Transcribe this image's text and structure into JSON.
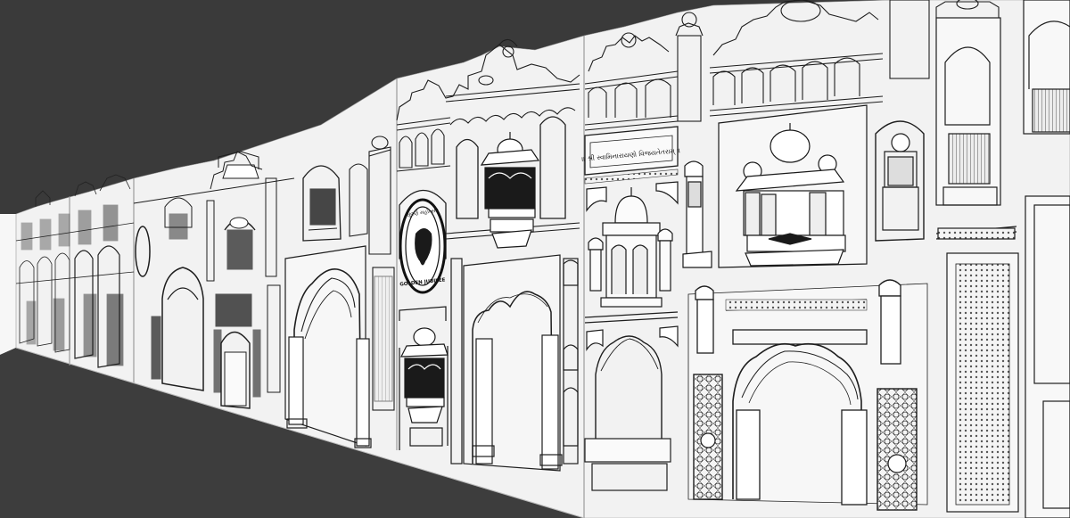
{
  "scene": {
    "background_color": "#3a3a3a",
    "wall_color": "#f2f2f2",
    "line_color": "#333333"
  },
  "medallion": {
    "text_top": "સુવર્ણ મહોત્સવ",
    "text_bottom": "GOLDEN JUBILEE"
  },
  "panel_text": "॥ શ્રી સ્વામિનારાયણો વિજયતેતરામ્ ॥"
}
